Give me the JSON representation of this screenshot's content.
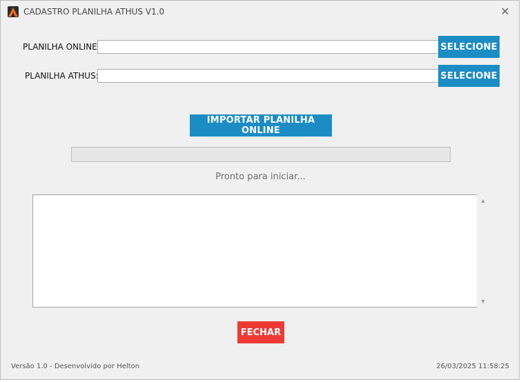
{
  "window": {
    "title": "CADASTRO PLANILHA ATHUS V1.0",
    "close_glyph": "✕"
  },
  "rows": [
    {
      "label": "PLANILHA ONLINE:",
      "value": "",
      "button_label": "SELECIONE"
    },
    {
      "label": "PLANILHA ATHUS:",
      "value": "",
      "button_label": "SELECIONE"
    }
  ],
  "import_button_label": "IMPORTAR PLANILHA ONLINE",
  "progress": {
    "value_percent": 0
  },
  "status_text": "Pronto para iniciar...",
  "log": {
    "content": ""
  },
  "close_button_label": "FECHAR",
  "footer": {
    "left": "Versão 1.0 - Desenvolvido por Helton",
    "right": "26/03/2025 11:58:25"
  },
  "colors": {
    "primary_button": "#1c8cc4",
    "close_button": "#ee3a35",
    "window_bg": "#f0f0f0"
  },
  "icons": {
    "app": "spreadsheet-app-icon",
    "close": "close-icon",
    "scroll_up": "scroll-up-arrow-icon",
    "scroll_down": "scroll-down-arrow-icon"
  }
}
